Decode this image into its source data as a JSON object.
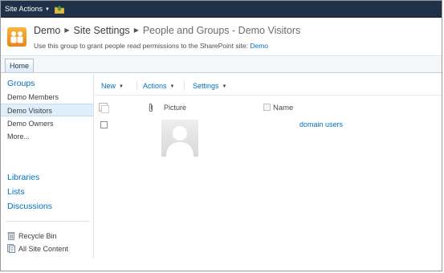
{
  "ribbon": {
    "site_actions_label": "Site Actions"
  },
  "title_area": {
    "breadcrumb": [
      "Demo",
      "Site Settings",
      "People and Groups - Demo Visitors"
    ],
    "description_prefix": "Use this group to grant people read permissions to the SharePoint site: ",
    "description_link": "Demo"
  },
  "top_nav": {
    "home_label": "Home"
  },
  "quick_launch": {
    "groups_header": "Groups",
    "group_items": [
      {
        "label": "Demo Members",
        "selected": false
      },
      {
        "label": "Demo Visitors",
        "selected": true
      },
      {
        "label": "Demo Owners",
        "selected": false
      },
      {
        "label": "More...",
        "selected": false
      }
    ],
    "section_headers": [
      "Libraries",
      "Lists",
      "Discussions"
    ],
    "utility_items": [
      {
        "label": "Recycle Bin",
        "icon": "recycle-bin-icon"
      },
      {
        "label": "All Site Content",
        "icon": "site-content-icon"
      }
    ]
  },
  "toolbar": {
    "new_label": "New",
    "actions_label": "Actions",
    "settings_label": "Settings"
  },
  "list_view": {
    "columns": [
      "Picture",
      "Name"
    ],
    "rows": [
      {
        "picture": "default-person-icon",
        "name": "domain users"
      }
    ]
  },
  "colors": {
    "ribbon_bg": "#20324a",
    "link": "#0072bc",
    "selected_bg": "#dfeefb"
  }
}
